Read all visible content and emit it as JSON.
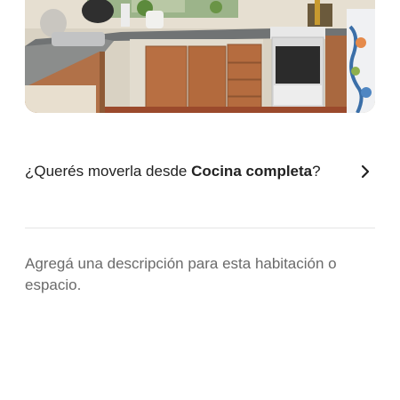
{
  "photo": {
    "alt_icon": "kitchen-photo"
  },
  "move_prompt": {
    "prefix": "¿Querés moverla desde ",
    "room": "Cocina completa",
    "suffix": "?",
    "chevron_icon": "chevron-right-icon"
  },
  "description": {
    "placeholder": "Agregá una descripción para esta habitación o espacio."
  }
}
